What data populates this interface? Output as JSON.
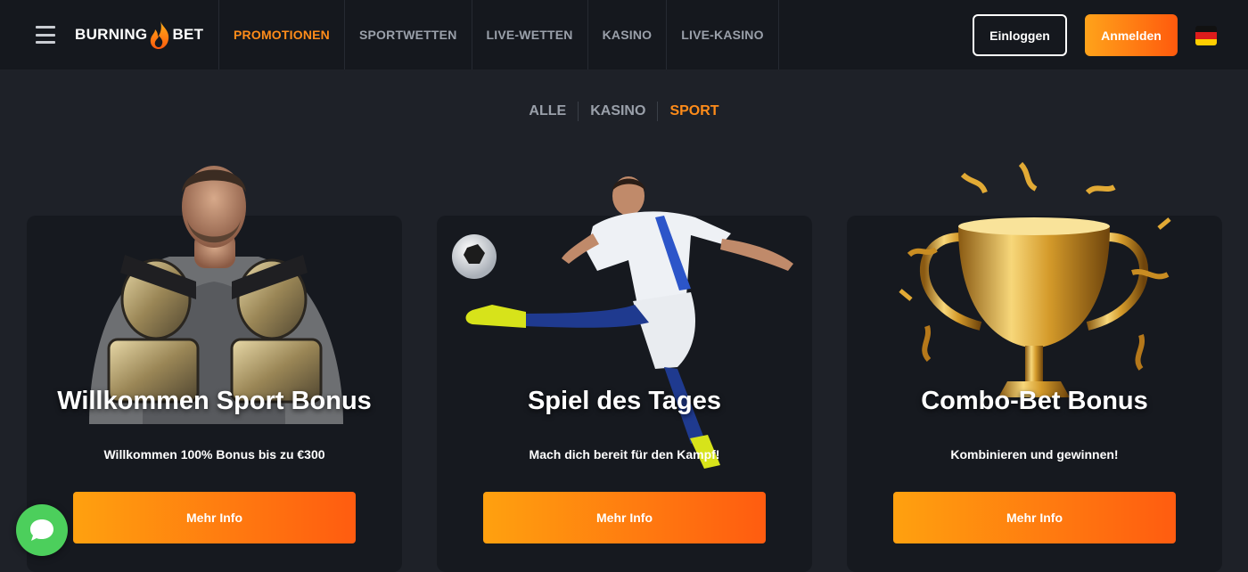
{
  "header": {
    "logo_left": "BURNING",
    "logo_right": "BET",
    "nav": [
      "PROMOTIONEN",
      "SPORTWETTEN",
      "LIVE-WETTEN",
      "KASINO",
      "LIVE-KASINO"
    ],
    "login_label": "Einloggen",
    "register_label": "Anmelden",
    "language_flag": "de-flag-icon"
  },
  "filters": [
    "ALLE",
    "KASINO",
    "SPORT"
  ],
  "active_filter": "SPORT",
  "cards": [
    {
      "title": "Willkommen Sport Bonus",
      "subtitle": "Willkommen 100% Bonus bis zu €300",
      "button": "Mehr Info",
      "art": "fighter-with-belts-illustration"
    },
    {
      "title": "Spiel des Tages",
      "subtitle": "Mach dich bereit für den Kampf!",
      "button": "Mehr Info",
      "art": "soccer-player-kicking-illustration"
    },
    {
      "title": "Combo-Bet Bonus",
      "subtitle": "Kombinieren und gewinnen!",
      "button": "Mehr Info",
      "art": "gold-trophy-confetti-illustration"
    }
  ],
  "colors": {
    "accent": "#ff8c1a",
    "button_gradient_start": "#ffa10f",
    "button_gradient_end": "#ff5c10",
    "background": "#1e2128",
    "header_bg": "#15181e",
    "card_bg": "#16191f",
    "chat_green": "#4ccf5c"
  },
  "chat_icon": "chat-bubble-icon"
}
